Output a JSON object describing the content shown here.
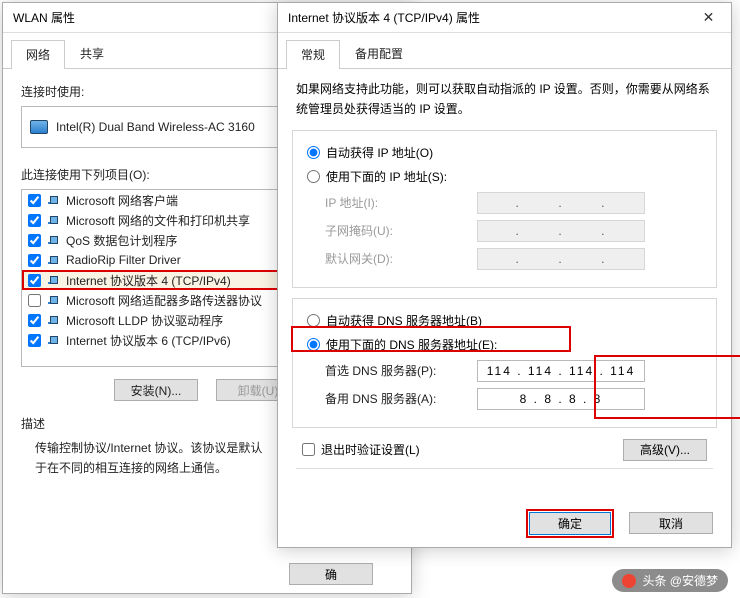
{
  "wlan": {
    "title": "WLAN 属性",
    "tabs": {
      "network": "网络",
      "share": "共享"
    },
    "connect_label": "连接时使用:",
    "adapter": "Intel(R) Dual Band Wireless-AC 3160",
    "items_label": "此连接使用下列项目(O):",
    "items": [
      {
        "checked": true,
        "label": "Microsoft 网络客户端"
      },
      {
        "checked": true,
        "label": "Microsoft 网络的文件和打印机共享"
      },
      {
        "checked": true,
        "label": "QoS 数据包计划程序"
      },
      {
        "checked": true,
        "label": "RadioRip Filter Driver"
      },
      {
        "checked": true,
        "label": "Internet 协议版本 4 (TCP/IPv4)",
        "selected": true
      },
      {
        "checked": false,
        "label": "Microsoft 网络适配器多路传送器协议"
      },
      {
        "checked": true,
        "label": "Microsoft LLDP 协议驱动程序"
      },
      {
        "checked": true,
        "label": "Internet 协议版本 6 (TCP/IPv6)"
      }
    ],
    "install_btn": "安装(N)...",
    "uninstall_btn": "卸载(U)",
    "desc_label": "描述",
    "desc_text1": "传输控制协议/Internet 协议。该协议是默认",
    "desc_text2": "于在不同的相互连接的网络上通信。",
    "ok_btn": "确"
  },
  "ipv4": {
    "title": "Internet 协议版本 4 (TCP/IPv4) 属性",
    "tabs": {
      "general": "常规",
      "alt": "备用配置"
    },
    "help": "如果网络支持此功能，则可以获取自动指派的 IP 设置。否则，你需要从网络系统管理员处获得适当的 IP 设置。",
    "ip_auto": "自动获得 IP 地址(O)",
    "ip_manual": "使用下面的 IP 地址(S):",
    "ip_addr": "IP 地址(I):",
    "subnet": "子网掩码(U):",
    "gateway": "默认网关(D):",
    "dns_auto": "自动获得 DNS 服务器地址(B)",
    "dns_manual": "使用下面的 DNS 服务器地址(E):",
    "dns_pref": "首选 DNS 服务器(P):",
    "dns_alt": "备用 DNS 服务器(A):",
    "dns_pref_val": "114 . 114 . 114 . 114",
    "dns_alt_val": "8  .  8  .  8  .  8",
    "validate": "退出时验证设置(L)",
    "advanced": "高级(V)...",
    "ok": "确定",
    "cancel": "取消"
  },
  "watermark": "头条 @安德梦"
}
